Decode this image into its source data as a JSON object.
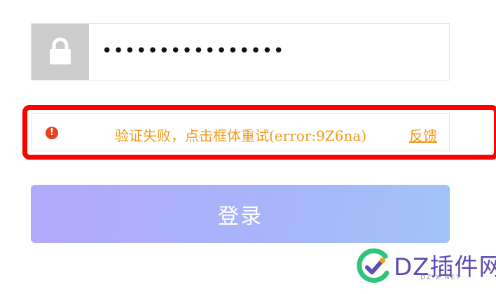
{
  "password_field": {
    "icon": "lock-icon",
    "value": "••••••••••••••••"
  },
  "captcha": {
    "icon": "exclamation-circle-icon",
    "message": "验证失败，点击框体重试(error:9Z6na)",
    "feedback_label": "反馈",
    "text_color": "#f09a1a",
    "highlight_color": "#ff0000"
  },
  "login_button": {
    "label": "登录"
  },
  "watermark": {
    "text": "DZ插件网",
    "sub": "DZ-X.NET"
  }
}
